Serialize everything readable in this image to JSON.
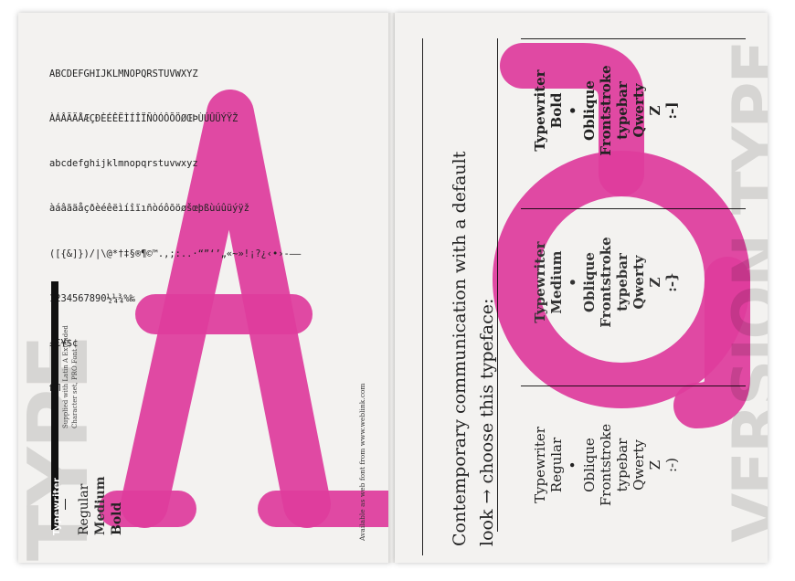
{
  "colors": {
    "accent": "#ea3fa7",
    "paper": "#f3f2f0",
    "ink": "#222222"
  },
  "left_page": {
    "charset_lines": [
      "ABCDEFGHIJKLMNOPQRSTUVWXYZ",
      "ÀÁÂÃÄÅÆÇĐÈÉÊËÌÍÎÏÑÒÓÔÕÖØŒÞÙÚÛÜÝŸŽ",
      "abcdefghijklmnopqrstuvwxyz",
      "àáâãäåçðèéêëìíîïıñòóôõöøšœþßùúûüýÿž",
      "([{&]})/|\\@*†‡§®¶©™.,;:..·“”‘’„«~»!¡?¿‹•›-–—",
      "1234567890½¼¾%‰",
      "£€¥$¢",
      "ﬁﬂ"
    ],
    "big_letter": "A",
    "typeface_name": "Typewriter",
    "weights": [
      "Regular",
      "Medium",
      "Bold"
    ],
    "supplied_note_1": "Supplied with Latin A Extended",
    "supplied_note_2": "Character set, PRO Font",
    "available_note": "Available as web font from www.weblink.com"
  },
  "right_page": {
    "big_glyph": "@",
    "headline_1": "Contemporary communication with a default",
    "headline_2": "look → choose this typeface:",
    "columns": [
      {
        "weight": "regular",
        "lines": [
          "Typewriter",
          "Regular",
          "•",
          "Oblique",
          "Frontstroke",
          "typebar",
          "Qwerty",
          "Z",
          ":-)"
        ]
      },
      {
        "weight": "medium",
        "lines": [
          "Typewriter",
          "Medium",
          "•",
          "Oblique",
          "Frontstroke",
          "typebar",
          "Qwerty",
          "Z",
          ":-}"
        ]
      },
      {
        "weight": "bold",
        "lines": [
          "Typewriter",
          "Bold",
          "•",
          "Oblique",
          "Frontstroke",
          "typebar",
          "Qwerty",
          "Z",
          ":-]"
        ]
      }
    ]
  }
}
